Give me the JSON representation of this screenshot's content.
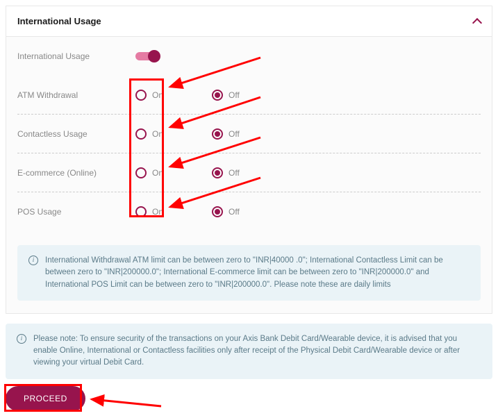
{
  "panel": {
    "title": "International Usage"
  },
  "rows": {
    "intl_usage": {
      "label": "International Usage",
      "toggle": true
    },
    "atm": {
      "label": "ATM Withdrawal",
      "on": "On",
      "off": "Off",
      "selected": "off"
    },
    "contactless": {
      "label": "Contactless Usage",
      "on": "On",
      "off": "Off",
      "selected": "off"
    },
    "ecom": {
      "label": "E-commerce (Online)",
      "on": "On",
      "off": "Off",
      "selected": "off"
    },
    "pos": {
      "label": "POS Usage",
      "on": "On",
      "off": "Off",
      "selected": "off"
    }
  },
  "info": {
    "limits": "International Withdrawal ATM limit can be between zero to \"INR|40000 .0\"; International Contactless Limit can be between zero to \"INR|200000.0\"; International E-commerce limit can be between zero to \"INR|200000.0\" and International POS Limit can be between zero to \"INR|200000.0\". Please note these are daily limits",
    "security_note": "Please note: To ensure security of the transactions on your Axis Bank Debit Card/Wearable device, it is advised that you enable Online, International or Contactless facilities only after receipt of the Physical Debit Card/Wearable device or after viewing your virtual Debit Card."
  },
  "actions": {
    "proceed": "PROCEED"
  },
  "colors": {
    "brand": "#97144d",
    "annotation": "#ff0000"
  }
}
